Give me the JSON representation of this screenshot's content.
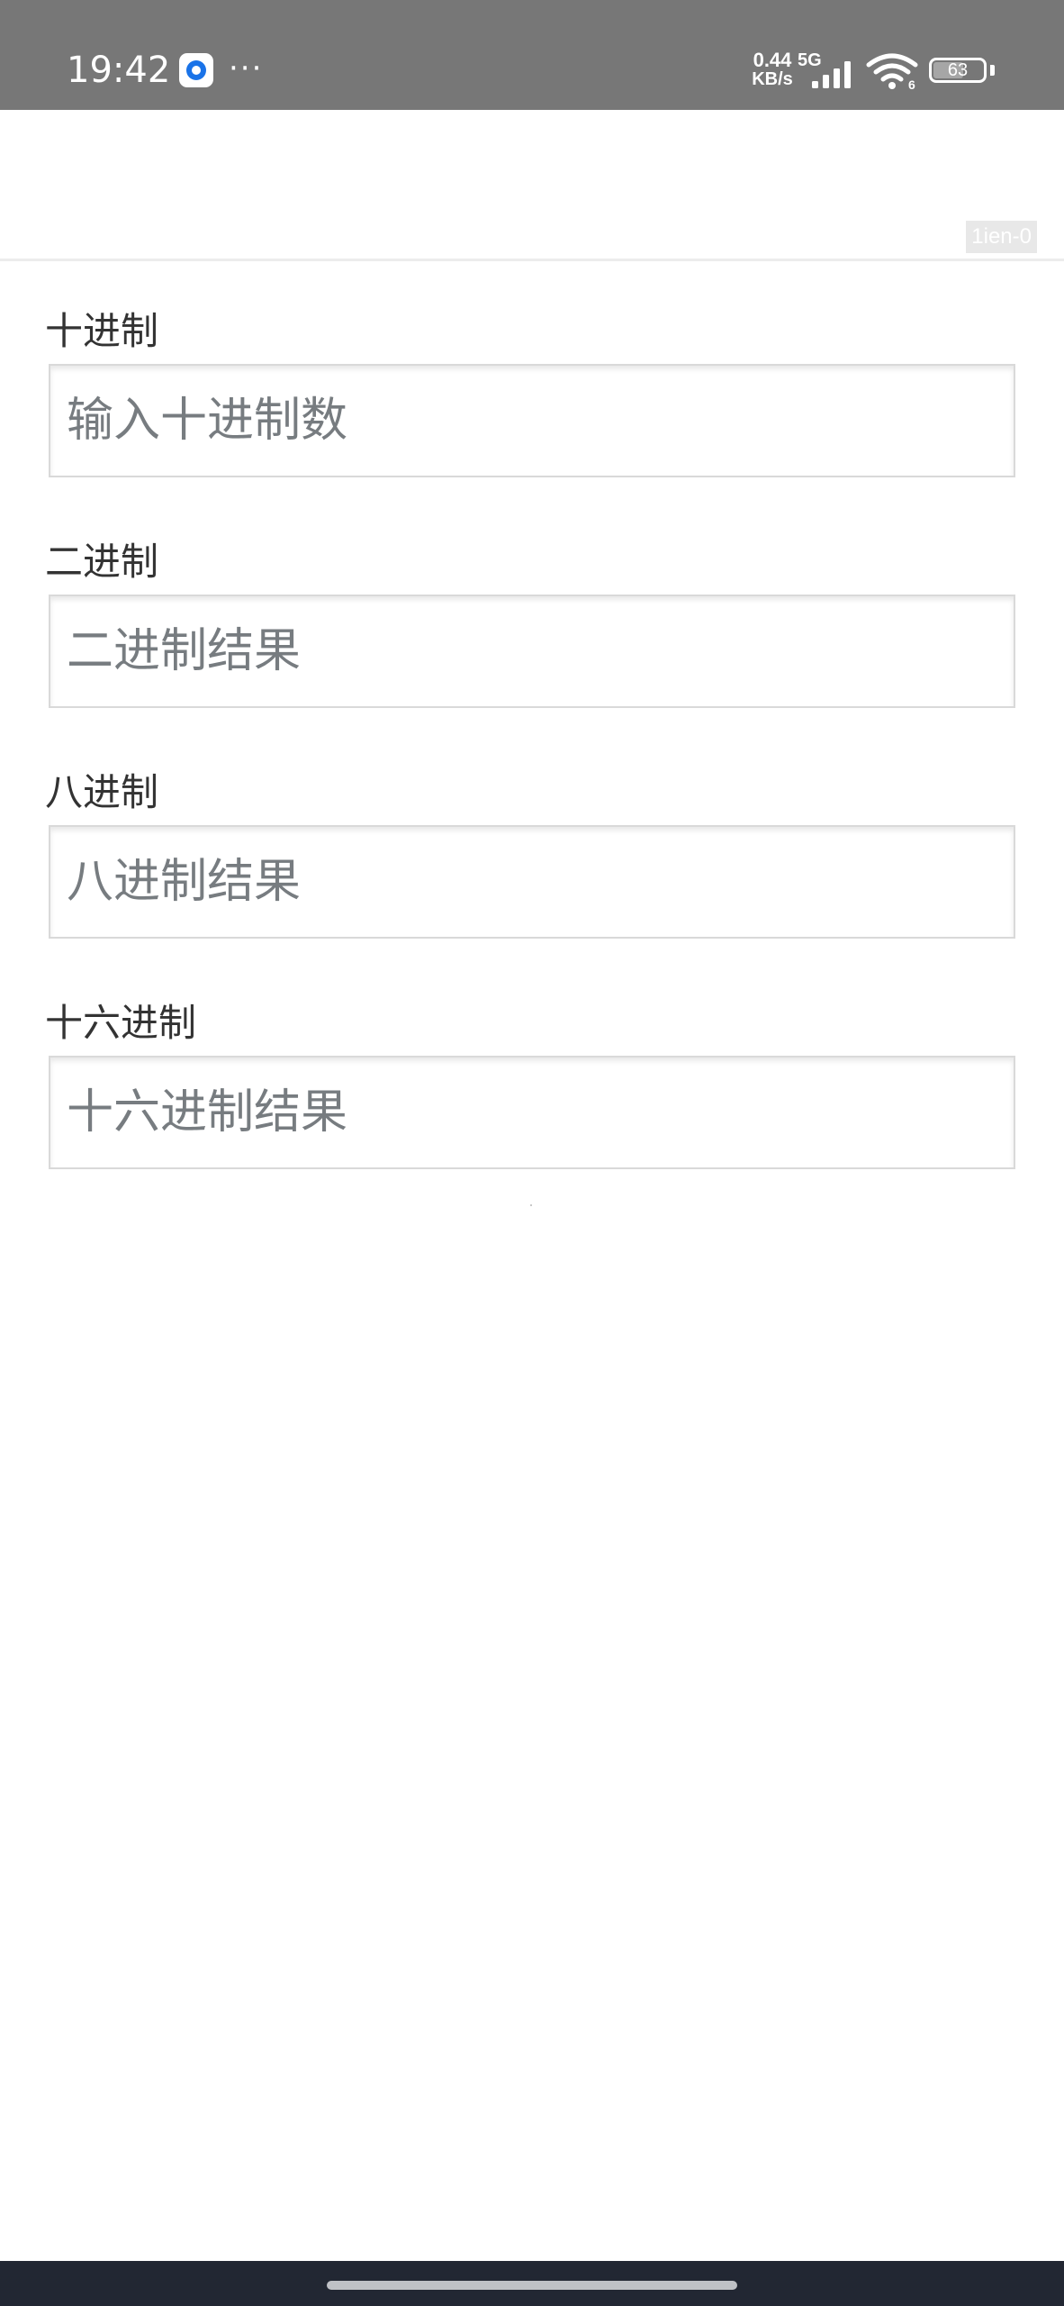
{
  "status_bar": {
    "time": "19:42",
    "more": "···",
    "net_speed_value": "0.44",
    "net_speed_unit": "KB/s",
    "network_type": "5G",
    "wifi_badge": "6",
    "battery_level": "63",
    "icons": [
      "notification-app-icon",
      "signal-icon",
      "wifi-icon",
      "battery-icon"
    ]
  },
  "header": {
    "tag": "1ien-0"
  },
  "fields": [
    {
      "label": "十进制",
      "placeholder": "输入十进制数",
      "value": ""
    },
    {
      "label": "二进制",
      "placeholder": "二进制结果",
      "value": ""
    },
    {
      "label": "八进制",
      "placeholder": "八进制结果",
      "value": ""
    },
    {
      "label": "十六进制",
      "placeholder": "十六进制结果",
      "value": ""
    }
  ],
  "colors": {
    "status_bar_bg": "#777777",
    "nav_bar_bg": "#222733",
    "placeholder": "#777c80",
    "label": "#333333",
    "input_border": "#d9d9d9"
  }
}
